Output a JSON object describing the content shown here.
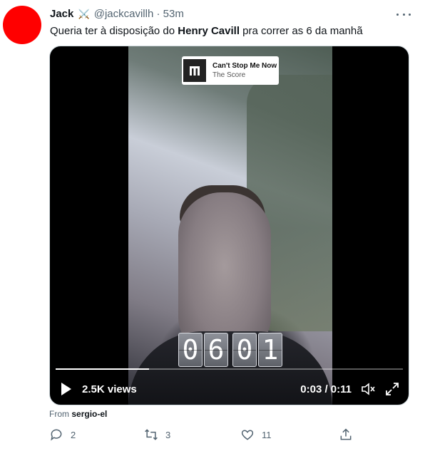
{
  "tweet": {
    "author_name": "Jack",
    "author_emoji": "⚔️",
    "author_handle": "@jackcavillh",
    "separator": "·",
    "time": "53m",
    "text_before": "Queria ter à disposição do ",
    "text_bold": "Henry Cavill",
    "text_after": " pra correr as 6 da manhã",
    "avatar_color": "#ff0000"
  },
  "video": {
    "music_title": "Can't Stop Me Now",
    "music_artist": "The Score",
    "clock_digits": [
      "0",
      "6",
      "0",
      "1"
    ],
    "views": "2.5K views",
    "timecode": "0:03 / 0:11",
    "progress": 0.27
  },
  "attribution": {
    "prefix": "From",
    "source": "sergio-el"
  },
  "actions": {
    "replies": "2",
    "retweets": "3",
    "likes": "11"
  },
  "icons": [
    "more-icon",
    "play-icon",
    "mute-icon",
    "fullscreen-icon",
    "reply-icon",
    "retweet-icon",
    "like-icon",
    "share-icon"
  ]
}
